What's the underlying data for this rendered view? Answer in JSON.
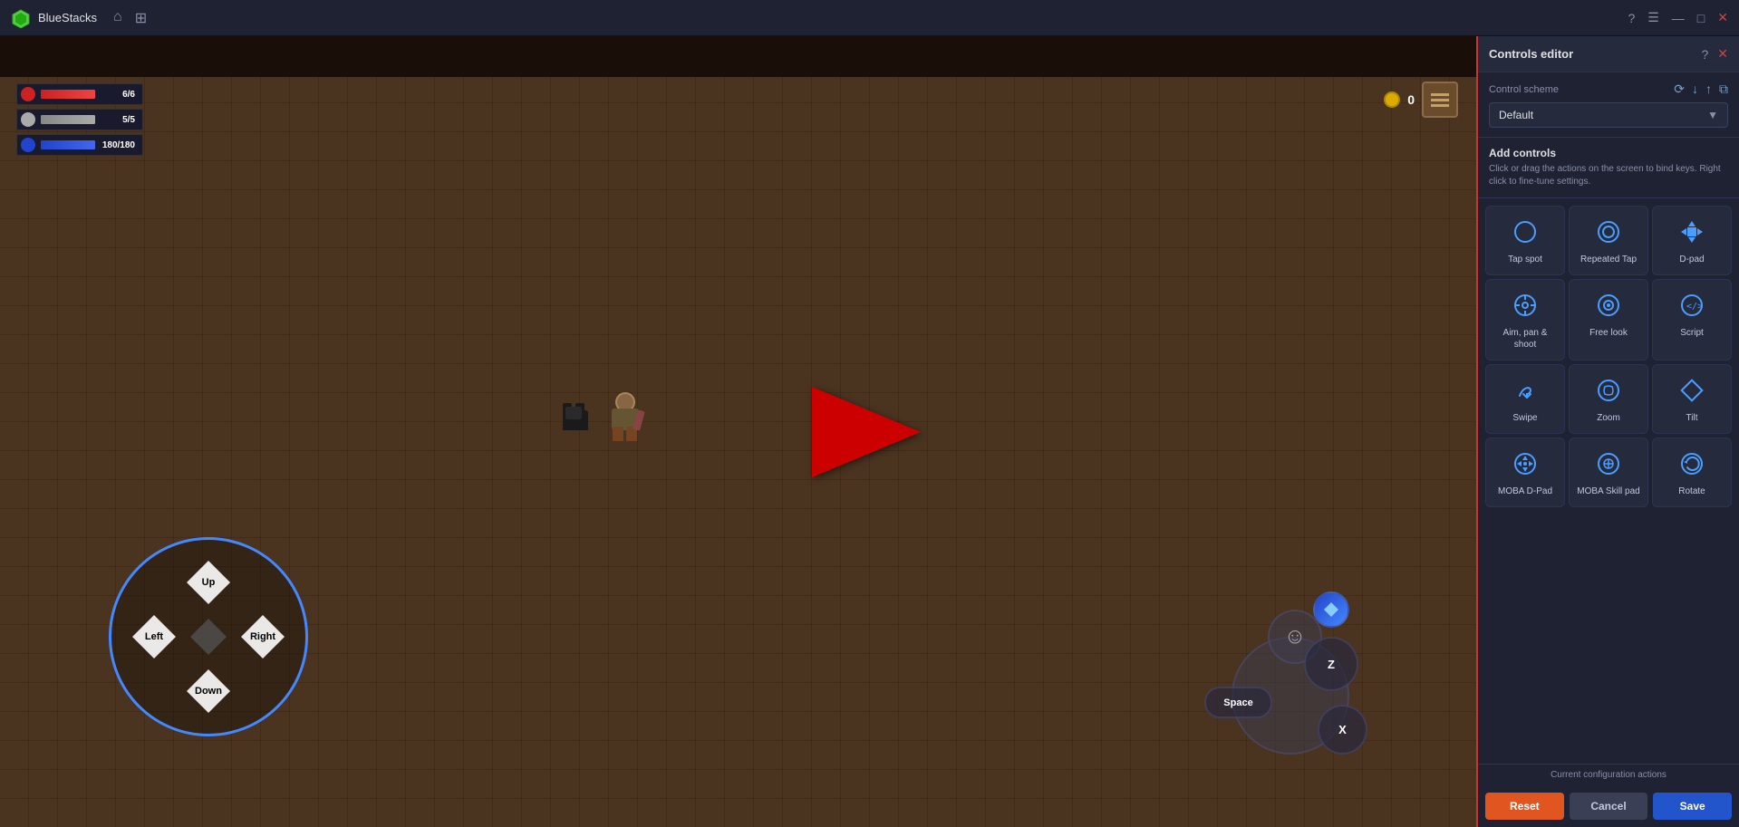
{
  "titlebar": {
    "app_name": "BlueStacks",
    "home_icon": "⌂",
    "grid_icon": "⊞",
    "help_icon": "?",
    "menu_icon": "☰",
    "minimize_icon": "—",
    "maximize_icon": "□",
    "close_icon": "✕"
  },
  "hud": {
    "hp": "6/6",
    "sp": "5/5",
    "mp": "180/180",
    "coins": "0"
  },
  "dpad": {
    "up": "Up",
    "down": "Down",
    "left": "Left",
    "right": "Right"
  },
  "action_buttons": {
    "z": "Z",
    "x": "X",
    "space": "Space"
  },
  "controls_panel": {
    "title": "Controls editor",
    "help_icon": "?",
    "close_icon": "✕",
    "control_scheme_label": "Control scheme",
    "scheme_value": "Default",
    "add_controls_title": "Add controls",
    "add_controls_desc": "Click or drag the actions on the screen to bind keys. Right click to fine-tune settings.",
    "controls": [
      {
        "id": "tap-spot",
        "label": "Tap spot",
        "icon": "circle"
      },
      {
        "id": "repeated-tap",
        "label": "Repeated Tap",
        "icon": "repeated-circle"
      },
      {
        "id": "d-pad",
        "label": "D-pad",
        "icon": "dpad"
      },
      {
        "id": "aim-pan-shoot",
        "label": "Aim, pan & shoot",
        "icon": "crosshair"
      },
      {
        "id": "free-look",
        "label": "Free look",
        "icon": "eye-circle"
      },
      {
        "id": "script",
        "label": "Script",
        "icon": "code"
      },
      {
        "id": "swipe",
        "label": "Swipe",
        "icon": "swipe"
      },
      {
        "id": "zoom",
        "label": "Zoom",
        "icon": "zoom"
      },
      {
        "id": "tilt",
        "label": "Tilt",
        "icon": "diamond"
      },
      {
        "id": "moba-dpad",
        "label": "MOBA D-Pad",
        "icon": "moba-dpad"
      },
      {
        "id": "moba-skill",
        "label": "MOBA Skill pad",
        "icon": "moba-skill"
      },
      {
        "id": "rotate",
        "label": "Rotate",
        "icon": "rotate"
      }
    ],
    "current_config_label": "Current configuration actions",
    "reset_label": "Reset",
    "cancel_label": "Cancel",
    "save_label": "Save"
  }
}
